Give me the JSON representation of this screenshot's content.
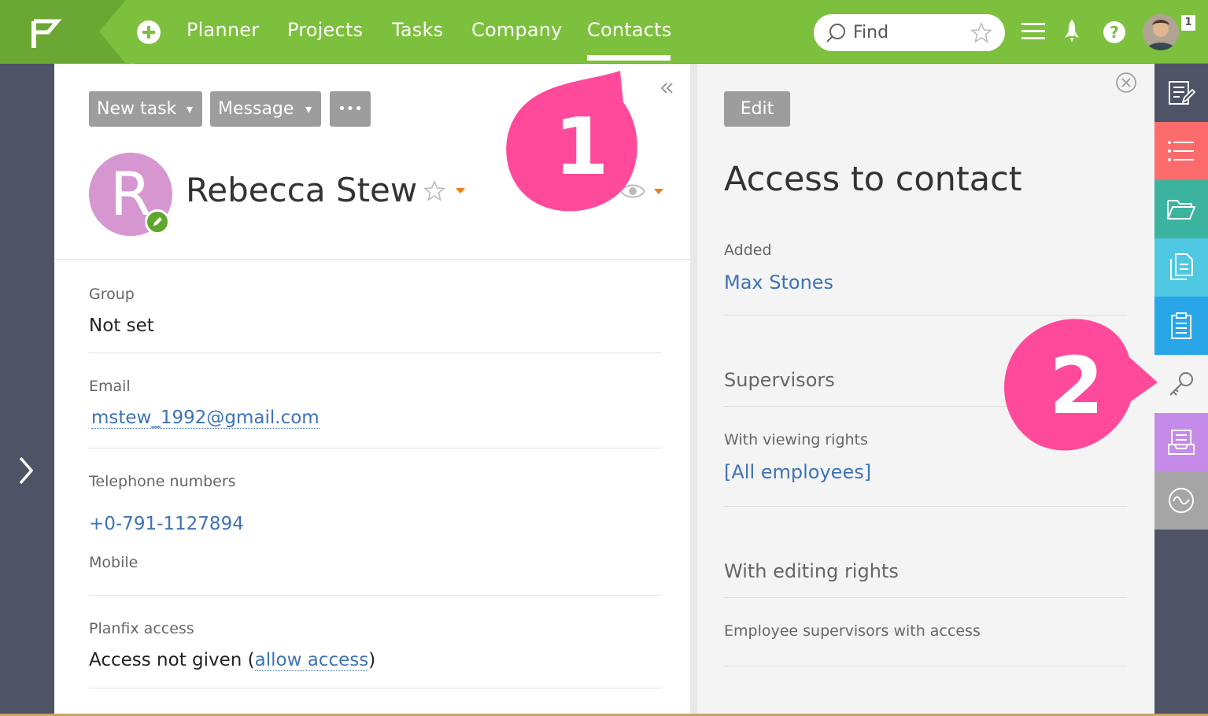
{
  "topbar": {
    "nav": [
      "Planner",
      "Projects",
      "Tasks",
      "Company",
      "Contacts"
    ],
    "active_nav": "Contacts",
    "search_placeholder": "Find",
    "notification_count": "1",
    "brand_color": "#7cc03d"
  },
  "toolbar": {
    "new_task": "New task",
    "message": "Message",
    "more": "•••",
    "caret": "▾"
  },
  "contact": {
    "initial": "R",
    "name": "Rebecca Stew",
    "avatar_color": "#d697d0"
  },
  "fields": {
    "group_label": "Group",
    "group_value": "Not set",
    "email_label": "Email",
    "email_value": "mstew_1992@gmail.com",
    "phone_label": "Telephone numbers",
    "phone_value": "+0-791-1127894",
    "phone_type": "Mobile",
    "access_label": "Planfix access",
    "access_text": "Access not given (",
    "access_link": "allow access",
    "access_close": ")"
  },
  "access_panel": {
    "edit": "Edit",
    "title": "Access to contact",
    "added_label": "Added",
    "added_by": "Max Stones",
    "supervisors": "Supervisors",
    "viewing_label": "With viewing rights",
    "viewing_value": "[All employees]",
    "editing_label": "With editing rights",
    "employee_supervisors": "Employee supervisors with access"
  },
  "callouts": [
    "1",
    "2"
  ],
  "callout_color": "#ff4a9b",
  "side_tab_colors": [
    "#4f5366",
    "#fb6b6b",
    "#3cb39f",
    "#4fc8e3",
    "#29a6e8",
    "#f4f4f4",
    "#c48ce8",
    "#a5a5a5"
  ]
}
